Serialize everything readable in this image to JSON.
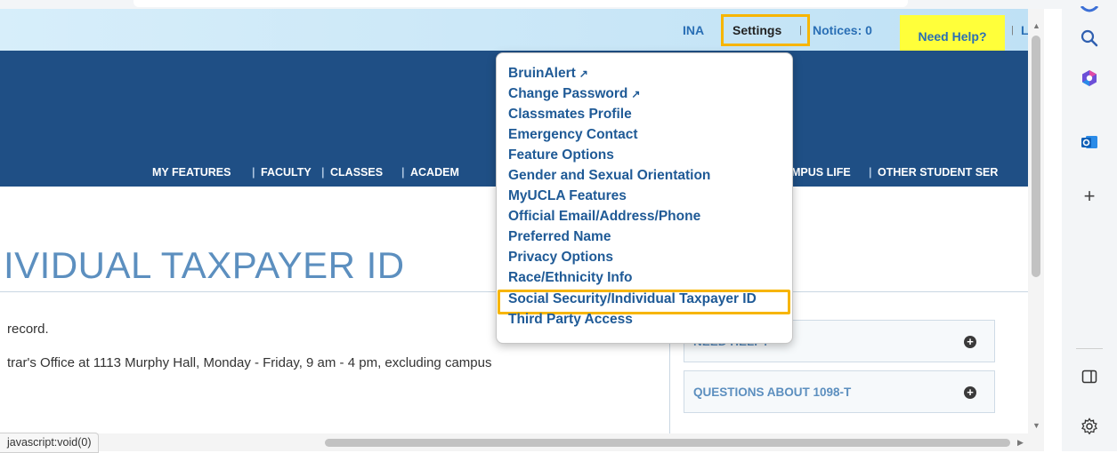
{
  "utility_bar": {
    "user": "INA",
    "settings": "Settings",
    "notices": "Notices: 0",
    "need_help": "Need Help?",
    "separator": "|",
    "truncated": "L"
  },
  "nav": {
    "items": [
      "MY FEATURES",
      "FACULTY",
      "CLASSES",
      "ACADEM",
      "MPUS LIFE",
      "OTHER STUDENT SER"
    ],
    "separator": "|"
  },
  "page": {
    "title": "IVIDUAL TAXPAYER ID",
    "line1": "record.",
    "line2": "trar's Office at 1113 Murphy Hall, Monday - Friday, 9 am - 4 pm, excluding campus"
  },
  "accordions": [
    {
      "label": "NEED HELP?"
    },
    {
      "label": "QUESTIONS ABOUT 1098-T"
    }
  ],
  "settings_menu": {
    "items": [
      {
        "label": "BruinAlert",
        "external": true
      },
      {
        "label": "Change Password",
        "external": true
      },
      {
        "label": "Classmates Profile",
        "external": false
      },
      {
        "label": "Emergency Contact",
        "external": false
      },
      {
        "label": "Feature Options",
        "external": false
      },
      {
        "label": "Gender and Sexual Orientation",
        "external": false
      },
      {
        "label": "MyUCLA Features",
        "external": false
      },
      {
        "label": "Official Email/Address/Phone",
        "external": false
      },
      {
        "label": "Preferred Name",
        "external": false
      },
      {
        "label": "Privacy Options",
        "external": false
      },
      {
        "label": "Race/Ethnicity Info",
        "external": false
      },
      {
        "label": "Social Security/Individual Taxpayer ID",
        "external": false,
        "highlighted": true
      },
      {
        "label": "Third Party Access",
        "external": false
      }
    ],
    "external_glyph": "↗"
  },
  "status_bar": {
    "text": "javascript:void(0)"
  },
  "sidebar_icons": [
    "search-icon",
    "copilot-icon",
    "outlook-icon",
    "add-icon",
    "split-screen-icon",
    "settings-icon"
  ],
  "colors": {
    "highlight_border": "#f7b500",
    "need_help_bg": "#ffff3a",
    "banner": "#1f4f85",
    "link": "#1f5a96"
  }
}
